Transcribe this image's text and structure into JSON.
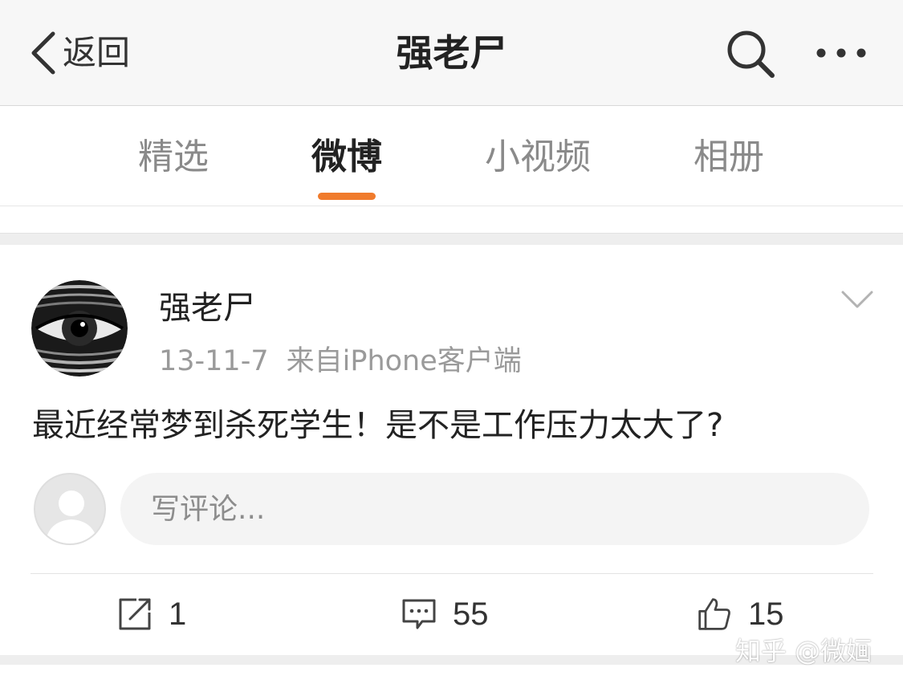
{
  "navbar": {
    "back_label": "返回",
    "title": "强老尸",
    "search_icon": "search-icon",
    "more_icon": "more-dots-icon"
  },
  "tabs": [
    {
      "label": "精选",
      "active": false
    },
    {
      "label": "微博",
      "active": true
    },
    {
      "label": "小视频",
      "active": false
    },
    {
      "label": "相册",
      "active": false
    }
  ],
  "accent_color": "#f07b2c",
  "post": {
    "author": "强老尸",
    "date": "13-11-7",
    "source": "来自iPhone客户端",
    "text": "最近经常梦到杀死学生！是不是工作压力太大了?",
    "comment_placeholder": "写评论...",
    "actions": {
      "repost_count": "1",
      "comment_count": "55",
      "like_count": "15"
    }
  },
  "watermark": "知乎 @微婳"
}
